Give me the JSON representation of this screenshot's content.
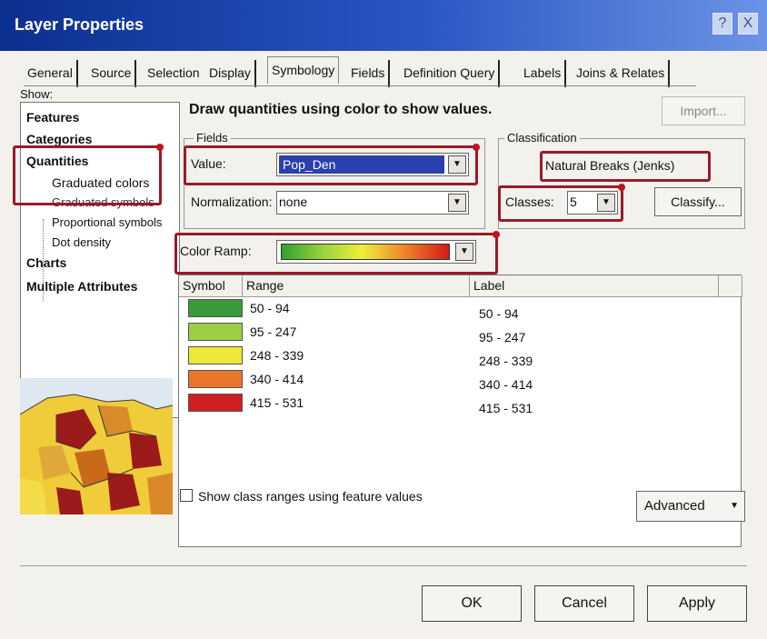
{
  "window": {
    "title": "Layer Properties",
    "help_glyph": "?",
    "close_glyph": "X"
  },
  "tabs": [
    {
      "label": "General"
    },
    {
      "label": "Source"
    },
    {
      "label": "Selection"
    },
    {
      "label": "Display"
    },
    {
      "label": "Symbology"
    },
    {
      "label": "Fields"
    },
    {
      "label": "Definition Query"
    },
    {
      "label": "Labels"
    },
    {
      "label": "Joins & Relates"
    }
  ],
  "active_tab": "Symbology",
  "show": {
    "label": "Show:",
    "items": [
      {
        "label": "Features"
      },
      {
        "label": "Categories"
      },
      {
        "label": "Quantities"
      },
      {
        "label": "Graduated colors"
      },
      {
        "label": "Graduated symbols"
      },
      {
        "label": "Proportional symbols"
      },
      {
        "label": "Dot density"
      },
      {
        "label": "Charts"
      },
      {
        "label": "Multiple Attributes"
      }
    ]
  },
  "main": {
    "headline": "Draw quantities using color to show values.",
    "import_label": "Import..."
  },
  "fields": {
    "group_title": "Fields",
    "value_label": "Value:",
    "value_selected": "Pop_Den",
    "normalization_label": "Normalization:",
    "normalization_value": "none"
  },
  "classification": {
    "group_title": "Classification",
    "method": "Natural Breaks (Jenks)",
    "classes_label": "Classes:",
    "classes_value": "5",
    "classify_button": "Classify..."
  },
  "color_ramp": {
    "label": "Color Ramp:",
    "colors": [
      "#2ea02e",
      "#9bd43c",
      "#f0ee3a",
      "#f08a2a",
      "#d41a1a"
    ]
  },
  "class_table": {
    "headers": {
      "symbol": "Symbol",
      "range": "Range",
      "label": "Label"
    },
    "rows": [
      {
        "color": "#3a9a3a",
        "range": "50 - 94",
        "label": "50 - 94"
      },
      {
        "color": "#9ccf43",
        "range": "95 - 247",
        "label": "95 - 247"
      },
      {
        "color": "#ece738",
        "range": "248 - 339",
        "label": "248 - 339"
      },
      {
        "color": "#e8752c",
        "range": "340 - 414",
        "label": "340 - 414"
      },
      {
        "color": "#cf1f22",
        "range": "415 - 531",
        "label": "415 - 531"
      }
    ]
  },
  "show_ranges_checkbox": {
    "label": "Show class ranges using feature values",
    "checked": false
  },
  "advanced_button": "Advanced",
  "buttons": {
    "ok": "OK",
    "cancel": "Cancel",
    "apply": "Apply"
  },
  "annotation_color": "#9b1a2a"
}
